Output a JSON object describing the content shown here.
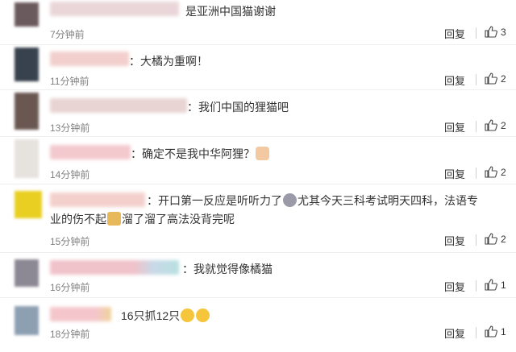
{
  "comments": [
    {
      "text": "是亚洲中国猫谢谢",
      "time": "7分钟前",
      "reply_label": "回复",
      "likes": "3",
      "avatar_color": "#6b5a5d",
      "nick_color": "#ead6d8"
    },
    {
      "text": "：大橘为重啊！",
      "time": "11分钟前",
      "reply_label": "回复",
      "likes": "2",
      "avatar_color": "#37424e",
      "nick_color": "#f2cfcd"
    },
    {
      "text": "：我们中国的狸猫吧",
      "time": "13分钟前",
      "reply_label": "回复",
      "likes": "2",
      "avatar_color": "#6a5752",
      "nick_color": "#e8d4d2"
    },
    {
      "text": "：确定不是我中华阿狸？",
      "time": "14分钟前",
      "reply_label": "回复",
      "likes": "2",
      "avatar_color": "#e6e2de",
      "nick_color": "#f3c9ce"
    },
    {
      "text_line1": "：开口第一反应是听听力了",
      "text_line1b": "尤其今天三科考试明天四科，法语专",
      "text_line2a": "业的伤不起",
      "text_line2b": "溜了溜了高法没背完呢",
      "time": "15分钟前",
      "reply_label": "回复",
      "likes": "2",
      "avatar_color": "#e9cf22",
      "nick_color": "#f4d0cc"
    },
    {
      "text": "：我就觉得像橘猫",
      "time": "16分钟前",
      "reply_label": "回复",
      "likes": "1",
      "avatar_color": "#8c8894",
      "nick_color": "#f0c2c9"
    },
    {
      "text": "16只抓12只",
      "time": "18分钟前",
      "reply_label": "回复",
      "likes": "1",
      "avatar_color": "#8da0b2",
      "nick_color": "#f4c6cb"
    }
  ],
  "icons": {
    "like": "thumbs-up-icon",
    "cat_emoji": "cat-face-emoji-icon",
    "crying_emoji": "crying-face-emoji-icon",
    "sticker_emoji": "sticker-emoji-icon"
  },
  "colors": {
    "time_text": "#808080",
    "body_text": "#333333",
    "emoji_yellow": "#f5c63c"
  }
}
